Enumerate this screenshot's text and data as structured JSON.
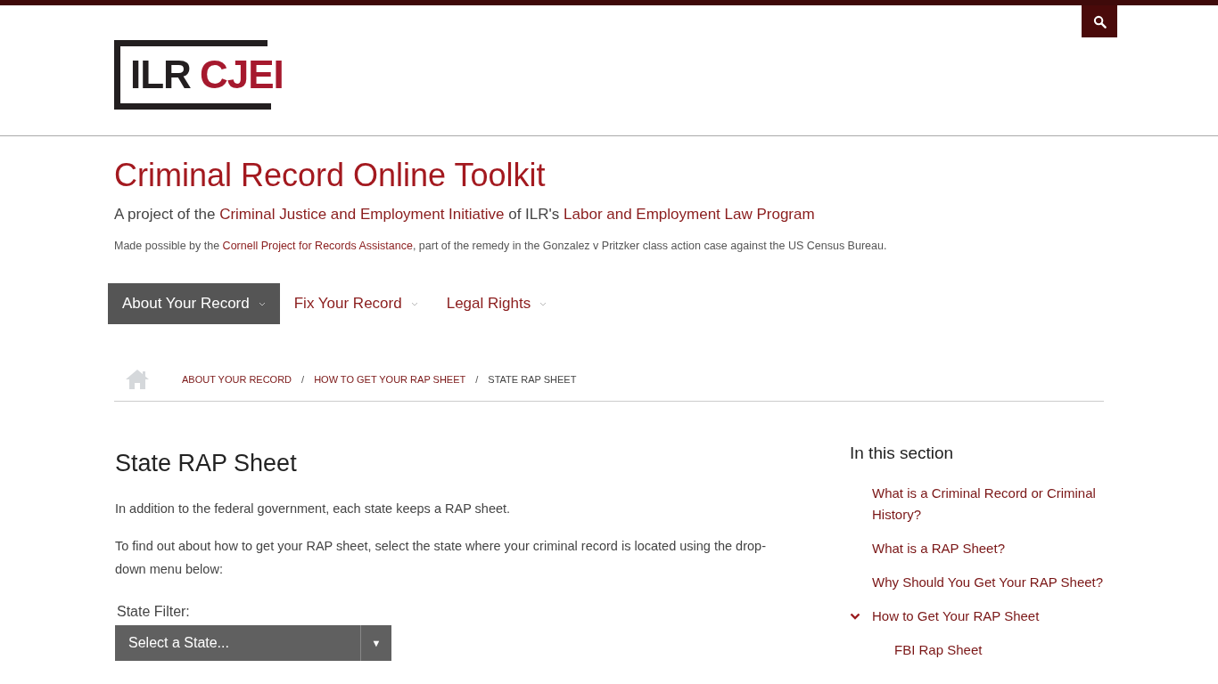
{
  "logo": {
    "left": "ILR",
    "right": "CJEI"
  },
  "site_title": "Criminal Record Online Toolkit",
  "tagline": [
    {
      "kind": "text",
      "text": "A project of the "
    },
    {
      "kind": "link",
      "text": "Criminal Justice and Employment Initiative"
    },
    {
      "kind": "text",
      "text": " of ILR's "
    },
    {
      "kind": "link",
      "text": "Labor and Employment Law Program"
    }
  ],
  "note": [
    {
      "kind": "text",
      "text": "Made possible by the "
    },
    {
      "kind": "link",
      "text": "Cornell Project for Records Assistance"
    },
    {
      "kind": "text",
      "text": ", part of the remedy in the Gonzalez v Pritzker class action case against the US Census Bureau."
    }
  ],
  "nav": [
    {
      "label": "About Your Record",
      "selected": true
    },
    {
      "label": "Fix Your Record",
      "selected": false
    },
    {
      "label": "Legal Rights",
      "selected": false
    }
  ],
  "breadcrumb": [
    {
      "label": "ABOUT YOUR RECORD",
      "kind": "link"
    },
    {
      "label": "HOW TO GET YOUR RAP SHEET",
      "kind": "link"
    },
    {
      "label": "STATE RAP SHEET",
      "kind": "current"
    }
  ],
  "breadcrumb_separator": "/",
  "page_title": "State RAP Sheet",
  "paragraphs": [
    "In addition to the federal government, each state keeps a RAP sheet.",
    "To find out about how to get your RAP sheet, select the state where your criminal record is located using the drop-down menu below:"
  ],
  "filter": {
    "label": "State Filter:",
    "value": "Select a State...",
    "arrow": "▼"
  },
  "sidebar": {
    "title": "In this section",
    "items": [
      {
        "label": "What is a Criminal Record or Criminal History?"
      },
      {
        "label": "What is a RAP Sheet?"
      },
      {
        "label": "Why Should You Get Your RAP Sheet?"
      },
      {
        "label": "How to Get Your RAP Sheet",
        "expanded": true,
        "children": [
          {
            "label": "FBI Rap Sheet"
          }
        ]
      }
    ]
  }
}
